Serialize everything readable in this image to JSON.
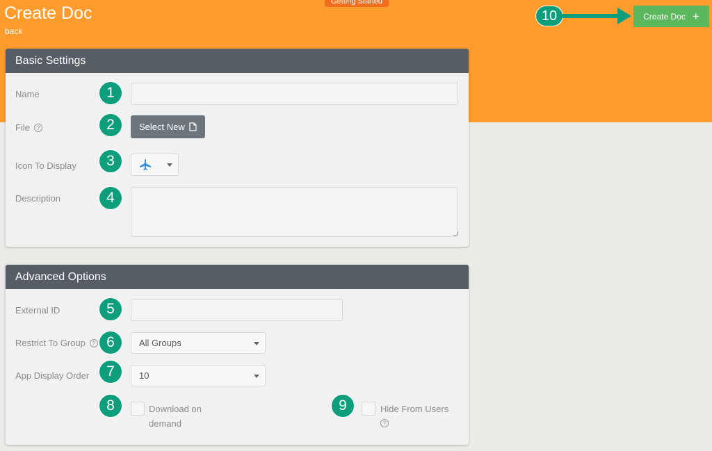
{
  "header": {
    "title": "Create Doc",
    "back_label": "back",
    "getting_started_label": "Getting Started",
    "create_button_label": "Create Doc",
    "create_button_icon": "plus-icon"
  },
  "basic_settings": {
    "title": "Basic Settings",
    "name_label": "Name",
    "name_value": "",
    "file_label": "File",
    "file_help_icon": "help-icon",
    "select_new_label": "Select New",
    "select_new_icon": "file-icon",
    "icon_label": "Icon To Display",
    "icon_selected": "airplane-icon",
    "description_label": "Description",
    "description_value": ""
  },
  "advanced_options": {
    "title": "Advanced Options",
    "external_id_label": "External ID",
    "external_id_value": "",
    "restrict_group_label": "Restrict To Group",
    "restrict_group_value": "All Groups",
    "display_order_label": "App Display Order",
    "display_order_value": "10",
    "download_label": "Download on demand",
    "download_checked": false,
    "hide_label": "Hide From Users",
    "hide_checked": false
  },
  "callouts": [
    "1",
    "2",
    "3",
    "4",
    "5",
    "6",
    "7",
    "8",
    "9",
    "10"
  ],
  "colors": {
    "header_bg": "#fe9b2d",
    "card_header_bg": "#565d64",
    "primary_button": "#5cb85c",
    "callout": "#0e9e7c",
    "icon_blue": "#3a8fe0"
  }
}
